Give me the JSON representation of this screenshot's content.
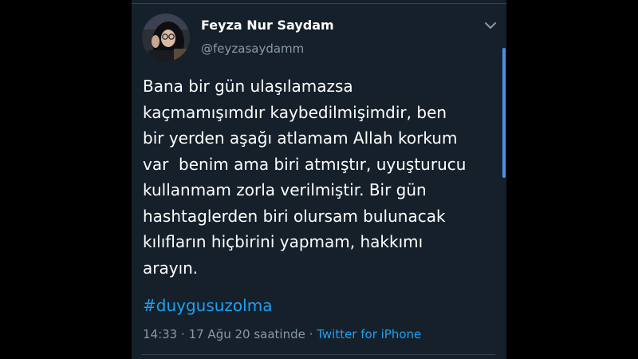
{
  "user": {
    "display_name": "Feyza Nur Saydam",
    "handle": "@feyzasaydamm"
  },
  "tweet": {
    "lines": [
      "Bana bir gün ulaşılamazsa",
      "kaçmamışımdır kaybedilmişimdir, ben",
      "bir yerden aşağı atlamam Allah korkum",
      "var  benim ama biri atmıştır, uyuşturucu",
      "kullanmam zorla verilmiştir. Bir gün",
      "hashtaglerden biri olursam bulunacak",
      "kılıfların hiçbirini yapmam, hakkımı",
      "arayın."
    ],
    "hashtag": "#duygusuzolma",
    "time": "14:33",
    "separator": "·",
    "date": "17 Ağu 20 saatinde",
    "source": "Twitter for iPhone"
  },
  "icons": {
    "chevron": "chevron-down-icon",
    "avatar": "avatar"
  },
  "colors": {
    "background": "#15202b",
    "outer": "#000000",
    "text": "#ffffff",
    "secondary": "#8899a6",
    "accent": "#1da1f2",
    "divider": "#38444d"
  }
}
